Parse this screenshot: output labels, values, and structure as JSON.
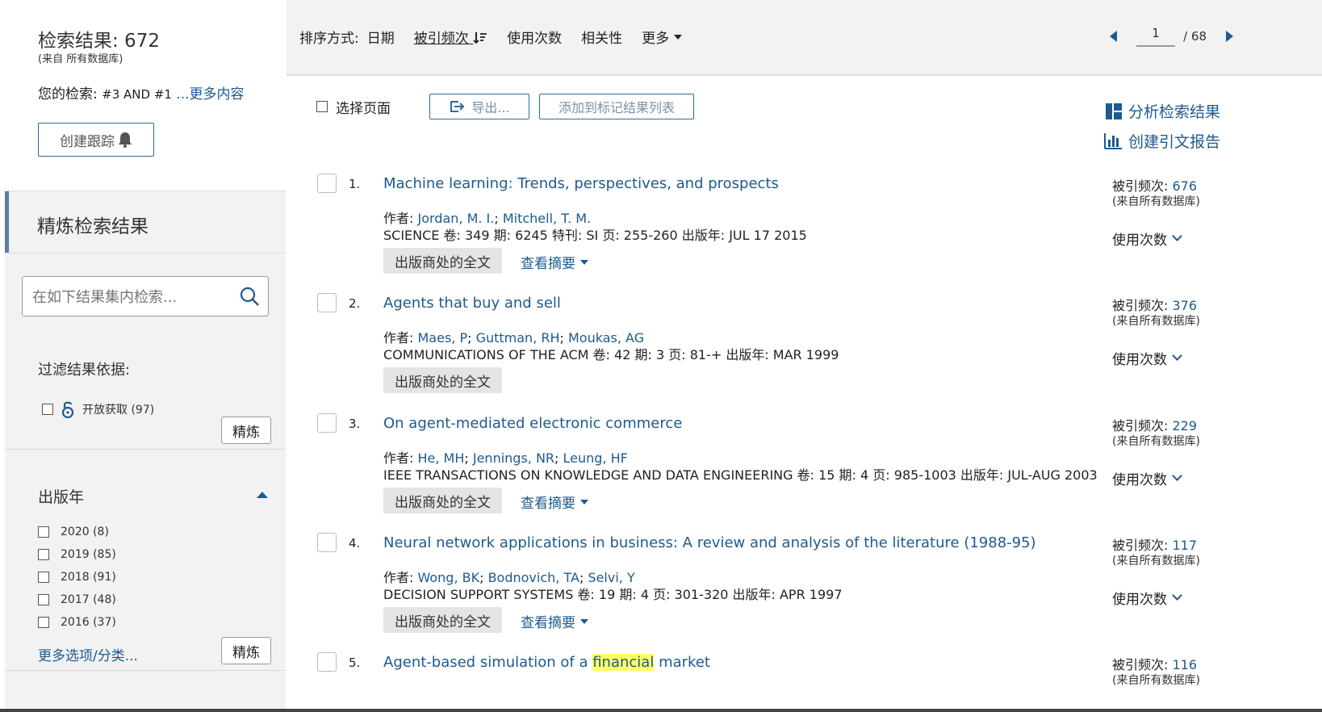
{
  "sidebar": {
    "results_label": "检索结果: 672",
    "results_source": "(来自 所有数据库)",
    "your_search_label": "您的检索: ",
    "your_search_query": "#3 AND #1",
    "your_search_more": " ...更多内容",
    "create_alert": "创建跟踪",
    "refine_title": "精炼检索结果",
    "search_placeholder": "在如下结果集内检索...",
    "filter_label": "过滤结果依据:",
    "open_access": "开放获取 (97)",
    "refine_button": "精炼",
    "pub_year_title": "出版年",
    "years": [
      "2020 (8)",
      "2019 (85)",
      "2018 (91)",
      "2017 (48)",
      "2016 (37)"
    ],
    "more_options": "更多选项/分类..."
  },
  "topbar": {
    "sort_label": "排序方式:",
    "sort_options": [
      "日期",
      "被引频次",
      "使用次数",
      "相关性",
      "更多"
    ],
    "page_current": "1",
    "page_total": "/ 68"
  },
  "toolbar": {
    "select_page": "选择页面",
    "export": "导出...",
    "add_marked": "添加到标记结果列表",
    "analyze": "分析检索结果",
    "citation_report": "创建引文报告"
  },
  "labels": {
    "authors_prefix": "作者: ",
    "fulltext": "出版商处的全文",
    "abstract": "查看摘要",
    "cites_prefix": "被引频次: ",
    "cites_source": "(来自所有数据库)",
    "usage": "使用次数"
  },
  "records": [
    {
      "index": "1.",
      "title": "Machine learning: Trends, perspectives, and prospects",
      "authors": [
        "Jordan, M. I.",
        "Mitchell, T. M."
      ],
      "source": "SCIENCE  卷: 349  期: 6245  特刊: SI  页: 255-260  出版年: JUL 17 2015",
      "cites": "676",
      "has_abstract": true
    },
    {
      "index": "2.",
      "title": "Agents that buy and sell",
      "authors": [
        "Maes, P",
        "Guttman, RH",
        "Moukas, AG"
      ],
      "source": "COMMUNICATIONS OF THE ACM  卷: 42  期: 3  页: 81-+  出版年: MAR 1999",
      "cites": "376",
      "has_abstract": false
    },
    {
      "index": "3.",
      "title": "On agent-mediated electronic commerce",
      "authors": [
        "He, MH",
        "Jennings, NR",
        "Leung, HF"
      ],
      "source": "IEEE TRANSACTIONS ON KNOWLEDGE AND DATA ENGINEERING  卷: 15  期: 4  页: 985-1003  出版年: JUL-AUG 2003",
      "cites": "229",
      "has_abstract": true
    },
    {
      "index": "4.",
      "title": "Neural network applications in business: A review and analysis of the literature (1988-95)",
      "authors": [
        "Wong, BK",
        "Bodnovich, TA",
        "Selvi, Y"
      ],
      "source": "DECISION SUPPORT SYSTEMS  卷: 19  期: 4  页: 301-320  出版年: APR 1997",
      "cites": "117",
      "has_abstract": true
    },
    {
      "index": "5.",
      "title_before": "Agent-based simulation of a ",
      "title_highlight": "financial",
      "title_after": " market",
      "cites": "116"
    }
  ]
}
